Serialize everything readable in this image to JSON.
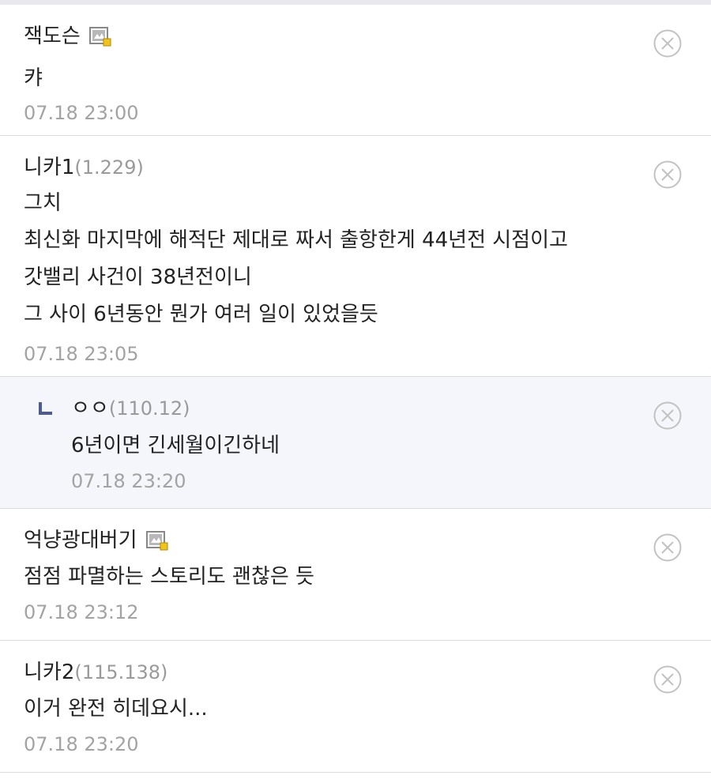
{
  "comments": [
    {
      "author": "잭도슨",
      "ip": "",
      "member_icon": "member-badge-icon",
      "lines": [
        "캬"
      ],
      "time": "07.18 23:00"
    },
    {
      "author": "니카1",
      "ip": "(1.229)",
      "lines": [
        "그치",
        "최신화 마지막에 해적단 제대로 짜서 출항한게 44년전 시점이고",
        "갓밸리 사건이 38년전이니",
        "그 사이 6년동안 뭔가 여러 일이 있었을듯"
      ],
      "time": "07.18 23:05"
    },
    {
      "author": "ㅇㅇ",
      "ip": "(110.12)",
      "is_reply": true,
      "lines": [
        "6년이면 긴세월이긴하네"
      ],
      "time": "07.18 23:20"
    },
    {
      "author": "억냥광대버기",
      "ip": "",
      "member_icon": "member-badge-icon",
      "lines": [
        "점점 파멸하는 스토리도 괜찮은 듯"
      ],
      "time": "07.18 23:12"
    },
    {
      "author": "니카2",
      "ip": "(115.138)",
      "lines": [
        "이거 완전 히데요시..."
      ],
      "time": "07.18 23:20"
    }
  ],
  "icons": {
    "delete": "close-circle-icon",
    "reply": "reply-arrow-icon"
  },
  "colors": {
    "reply_background": "#f4f6fb",
    "reply_arrow": "#4a5a9a",
    "meta_gray": "#a3a3a3"
  }
}
